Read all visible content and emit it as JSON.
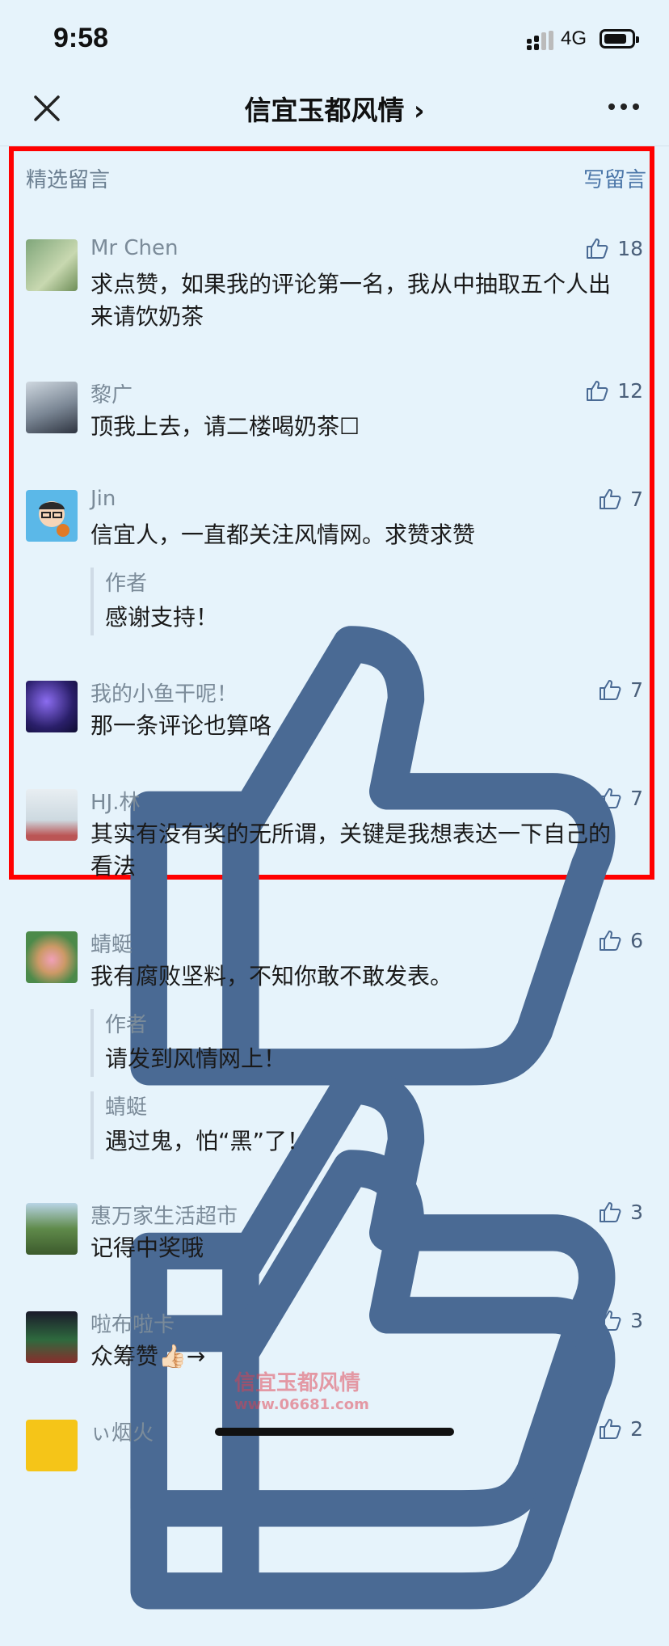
{
  "status": {
    "time": "9:58",
    "network": "4G",
    "battery_level": 0.85
  },
  "nav": {
    "title": "信宜玉都风情 ›"
  },
  "section": {
    "header": "精选留言",
    "write": "写留言"
  },
  "comments": [
    {
      "name": "Mr Chen",
      "text": "求点赞，如果我的评论第一名，我从中抽取五个人出来请饮奶茶",
      "likes": "18"
    },
    {
      "name": "黎广",
      "text": "顶我上去，请二楼喝奶茶☐",
      "likes": "12"
    },
    {
      "name": "Jin",
      "text": "信宜人，一直都关注风情网。求赞求赞",
      "likes": "7",
      "replies": [
        {
          "name": "作者",
          "text": "感谢支持！"
        }
      ]
    },
    {
      "name": "我的小鱼干呢！",
      "text": "那一条评论也算咯",
      "likes": "7"
    },
    {
      "name": "HJ.林",
      "text": "其实有没有奖的无所谓，关键是我想表达一下自己的看法",
      "likes": "7"
    },
    {
      "name": "蜻蜓",
      "text": "我有腐败坚料，不知你敢不敢发表。",
      "likes": "6",
      "replies": [
        {
          "name": "作者",
          "text": "请发到风情网上！"
        },
        {
          "name": "蜻蜓",
          "text": "遇过鬼，怕“黑”了！"
        }
      ]
    },
    {
      "name": "惠万家生活超市",
      "text": "记得中奖哦",
      "likes": "3"
    },
    {
      "name": "啦布啦卡",
      "text": "众筹赞👍🏻→",
      "likes": "3"
    },
    {
      "name": "ぃ烟火",
      "text": "",
      "likes": "2"
    }
  ],
  "watermark": {
    "line1": "信宜玉都风情",
    "line2": "www.06681.com"
  }
}
